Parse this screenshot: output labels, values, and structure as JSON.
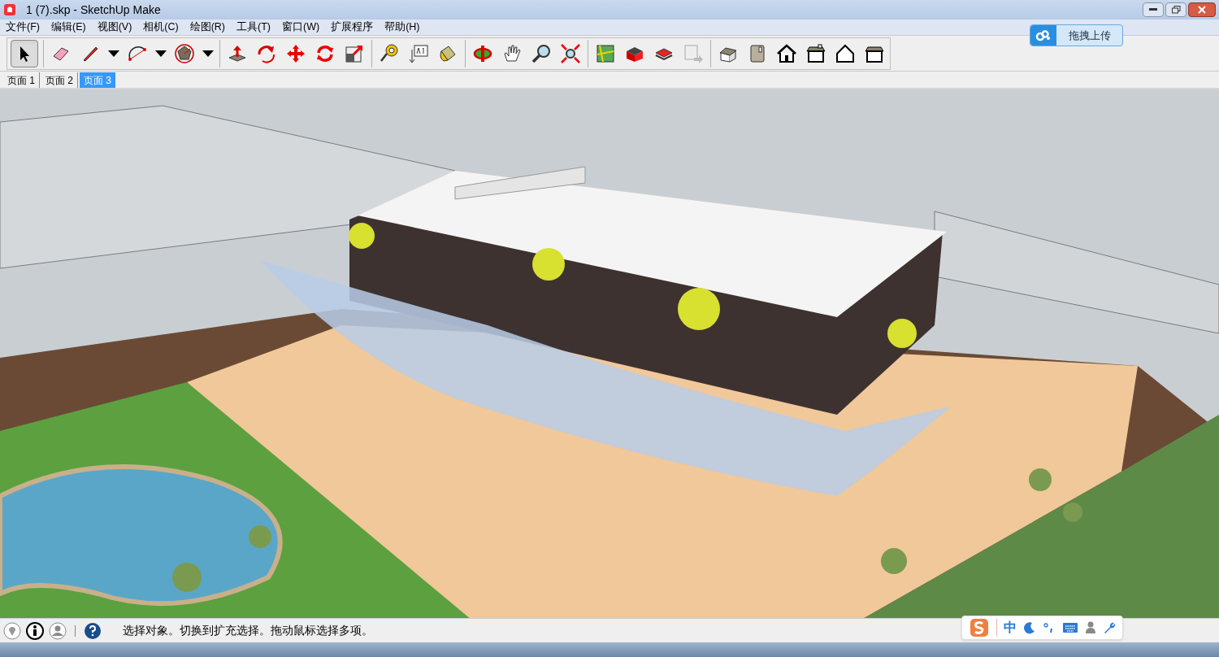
{
  "window": {
    "title": "1 (7).skp - SketchUp Make"
  },
  "menu": [
    "文件(F)",
    "编辑(E)",
    "视图(V)",
    "相机(C)",
    "绘图(R)",
    "工具(T)",
    "窗口(W)",
    "扩展程序",
    "帮助(H)"
  ],
  "upload_button": {
    "label": "拖拽上传"
  },
  "toolbar": [
    {
      "tools": [
        {
          "kind": "select",
          "selected": true
        }
      ]
    },
    {
      "tools": [
        {
          "kind": "eraser",
          "selected": false
        },
        {
          "kind": "pencil",
          "selected": false,
          "dropdown": true
        },
        {
          "kind": "arc",
          "selected": false,
          "dropdown": true
        },
        {
          "kind": "polygon",
          "selected": false,
          "dropdown": true
        }
      ]
    },
    {
      "tools": [
        {
          "kind": "pushpull",
          "selected": false
        },
        {
          "kind": "followme",
          "selected": false
        },
        {
          "kind": "move",
          "selected": false
        },
        {
          "kind": "rotate",
          "selected": false
        },
        {
          "kind": "scale",
          "selected": false
        }
      ]
    },
    {
      "tools": [
        {
          "kind": "tape",
          "selected": false
        },
        {
          "kind": "text",
          "selected": false
        },
        {
          "kind": "paint",
          "selected": false
        }
      ]
    },
    {
      "tools": [
        {
          "kind": "orbit",
          "selected": false
        },
        {
          "kind": "pan",
          "selected": false
        },
        {
          "kind": "zoom",
          "selected": false
        },
        {
          "kind": "extents",
          "selected": false
        }
      ]
    },
    {
      "tools": [
        {
          "kind": "map",
          "selected": false
        },
        {
          "kind": "warehouse",
          "selected": false
        },
        {
          "kind": "share",
          "selected": false
        },
        {
          "kind": "export",
          "selected": false
        }
      ]
    },
    {
      "tools": [
        {
          "kind": "iso",
          "selected": false
        },
        {
          "kind": "top",
          "selected": false
        },
        {
          "kind": "front",
          "selected": false
        },
        {
          "kind": "right",
          "selected": false
        },
        {
          "kind": "back",
          "selected": false
        },
        {
          "kind": "left",
          "selected": false
        }
      ]
    }
  ],
  "scene_tabs": [
    {
      "label": "页面 1",
      "selected": false
    },
    {
      "label": "页面 2",
      "selected": false
    },
    {
      "label": "页面 3",
      "selected": true
    }
  ],
  "status_bar": {
    "text": "选择对象。切换到扩充选择。拖动鼠标选择多项。"
  },
  "ime_bar": {
    "mode": "中"
  }
}
